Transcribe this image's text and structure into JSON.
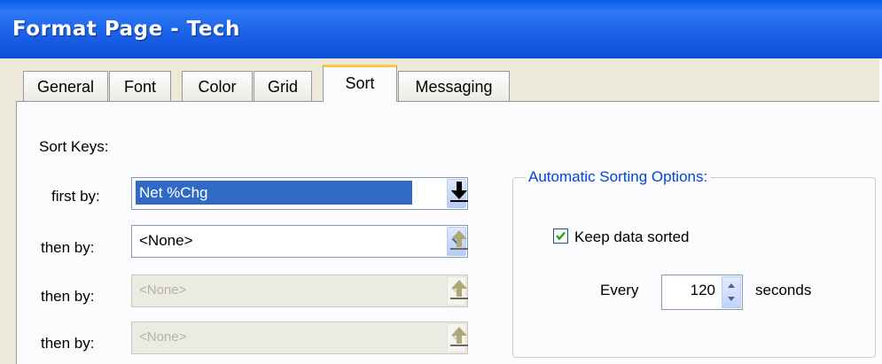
{
  "window": {
    "title": "Format Page - Tech"
  },
  "tabs": [
    {
      "label": "General",
      "active": false
    },
    {
      "label": "Font",
      "active": false
    },
    {
      "label": "Color",
      "active": false
    },
    {
      "label": "Grid",
      "active": false
    },
    {
      "label": "Sort",
      "active": true
    },
    {
      "label": "Messaging",
      "active": false
    }
  ],
  "sort": {
    "heading": "Sort Keys:",
    "rows": [
      {
        "label": "first by:",
        "value": "Net %Chg",
        "state": "selected",
        "arrow": "down-arrow-icon"
      },
      {
        "label": "then by:",
        "value": "<None>",
        "state": "enabled",
        "arrow": "up-arrow-icon"
      },
      {
        "label": "then by:",
        "value": "<None>",
        "state": "disabled",
        "arrow": "up-arrow-icon"
      },
      {
        "label": "then by:",
        "value": "<None>",
        "state": "disabled",
        "arrow": "up-arrow-icon"
      }
    ]
  },
  "auto": {
    "group_title": "Automatic Sorting Options:",
    "keep_sorted_label": "Keep data sorted",
    "keep_sorted_checked": true,
    "every_label": "Every",
    "interval": "120",
    "seconds_label": "seconds"
  },
  "colors": {
    "title_bar": "#1c62e8",
    "selection": "#316ac5",
    "group_title": "#0046d5",
    "active_tab_accent": "#ffc83c"
  }
}
